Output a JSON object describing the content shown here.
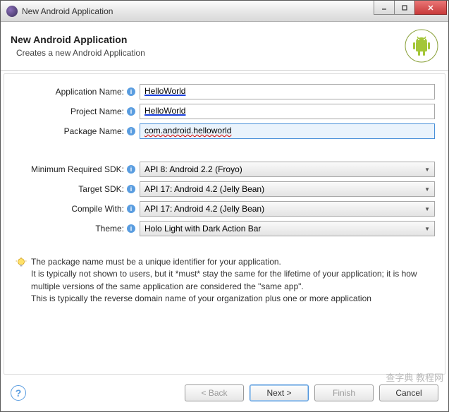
{
  "titlebar": {
    "title": "New Android Application"
  },
  "header": {
    "title": "New Android Application",
    "subtitle": "Creates a new Android Application"
  },
  "form": {
    "app_name": {
      "label": "Application Name:",
      "value": "HelloWorld"
    },
    "project_name": {
      "label": "Project Name:",
      "value": "HelloWorld"
    },
    "package_name": {
      "label": "Package Name:",
      "value_a": "com.android.",
      "value_b": "helloworld"
    },
    "min_sdk": {
      "label": "Minimum Required SDK:",
      "value": "API 8: Android 2.2 (Froyo)"
    },
    "target_sdk": {
      "label": "Target SDK:",
      "value": "API 17: Android 4.2 (Jelly Bean)"
    },
    "compile": {
      "label": "Compile With:",
      "value": "API 17: Android 4.2 (Jelly Bean)"
    },
    "theme": {
      "label": "Theme:",
      "value": "Holo Light with Dark Action Bar"
    }
  },
  "hint": {
    "line1": "The package name must be a unique identifier for your application.",
    "line2": "It is typically not shown to users, but it *must* stay the same for the lifetime of your application; it is how multiple versions of the same application are considered the \"same app\".",
    "line3": "This is typically the reverse domain name of your organization plus one or more application"
  },
  "buttons": {
    "back": "< Back",
    "next": "Next >",
    "finish": "Finish",
    "cancel": "Cancel"
  },
  "watermark": "查字典 教程网"
}
